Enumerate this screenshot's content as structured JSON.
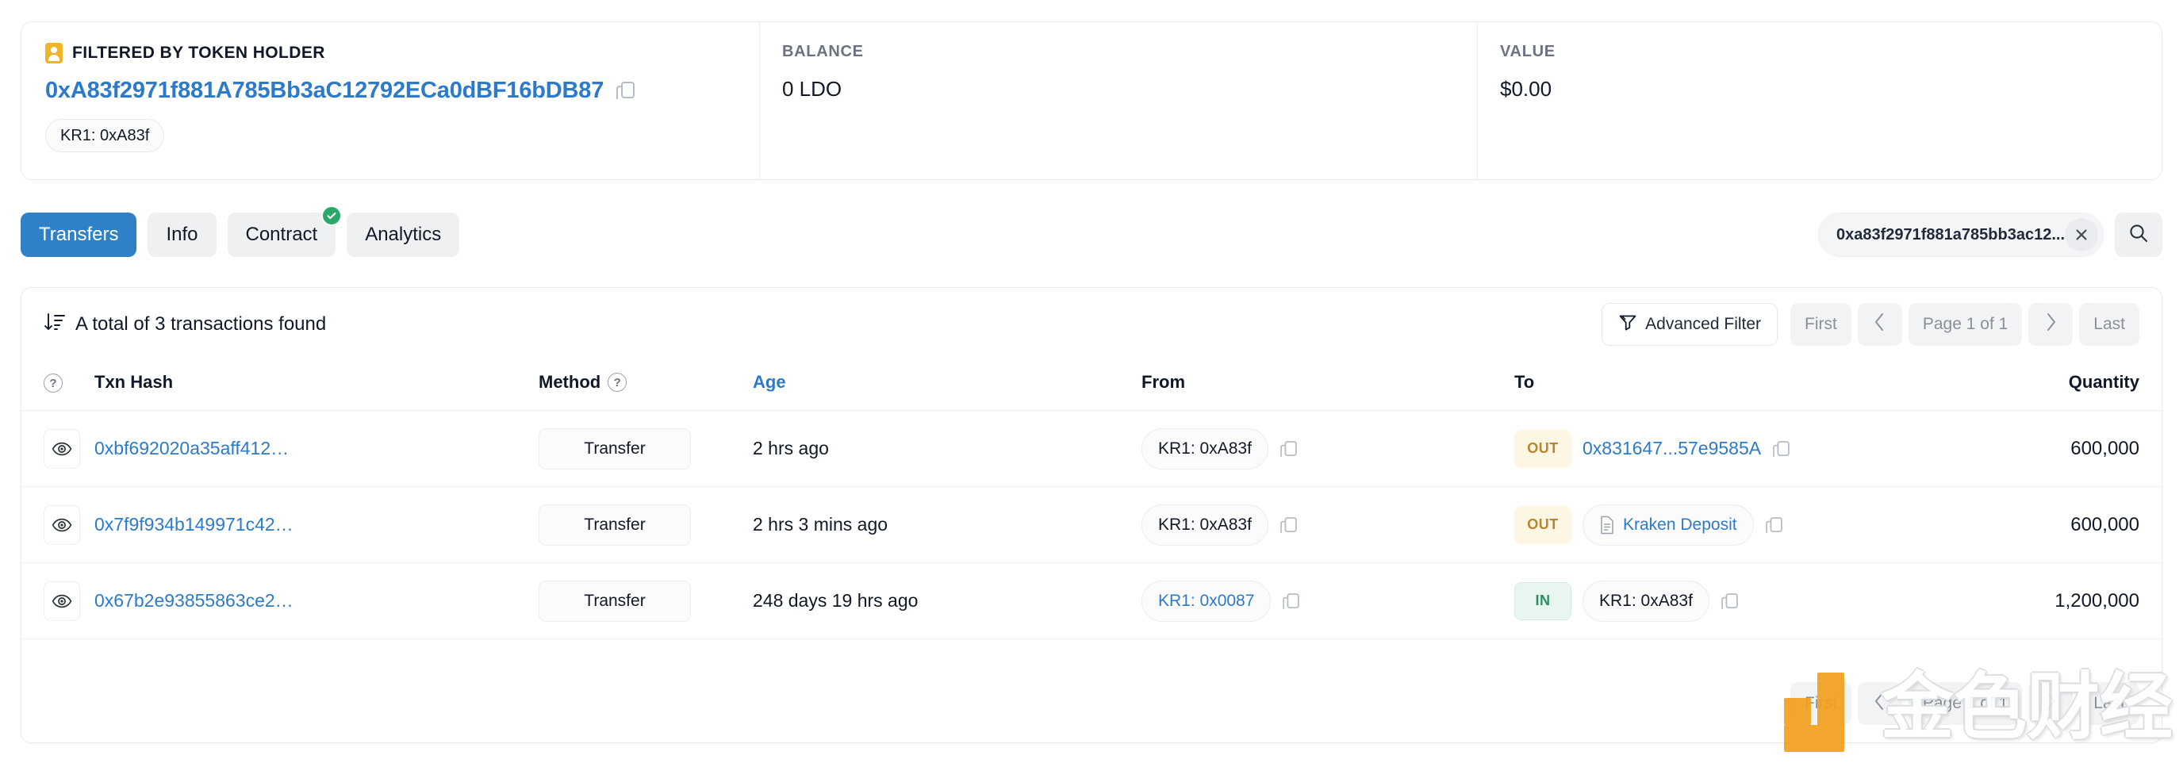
{
  "holder_card": {
    "filtered_label": "FILTERED BY TOKEN HOLDER",
    "holder_icon": "address-book-icon",
    "address": "0xA83f2971f881A785Bb3aC12792ECa0dBF16bDB87",
    "copy_icon": "copy-icon",
    "tag": "KR1: 0xA83f",
    "balance_label": "BALANCE",
    "balance_value": "0 LDO",
    "value_label": "VALUE",
    "value_value": "$0.00"
  },
  "tabs": [
    {
      "label": "Transfers",
      "active": true,
      "badge": false
    },
    {
      "label": "Info",
      "active": false,
      "badge": false
    },
    {
      "label": "Contract",
      "active": false,
      "badge": true
    },
    {
      "label": "Analytics",
      "active": false,
      "badge": false
    }
  ],
  "search": {
    "value": "0xa83f2971f881a785bb3ac12...",
    "clear_icon": "close-icon",
    "search_icon": "search-icon"
  },
  "toolbar": {
    "sort_icon": "sort-descending-icon",
    "total_text": "A total of 3 transactions found",
    "advanced_filter": "Advanced Filter",
    "filter_icon": "funnel-icon",
    "first": "First",
    "prev_icon": "chevron-left-icon",
    "page_label": "Page 1 of 1",
    "next_icon": "chevron-right-icon",
    "last": "Last"
  },
  "table": {
    "columns": {
      "help": "?",
      "txn_hash": "Txn Hash",
      "method": "Method",
      "method_help": "?",
      "age": "Age",
      "from": "From",
      "to": "To",
      "quantity": "Quantity"
    },
    "rows": [
      {
        "eye_icon": "eye-icon",
        "hash": "0xbf692020a35aff412…",
        "method": "Transfer",
        "age": "2 hrs ago",
        "from": {
          "label": "KR1: 0xA83f",
          "link": false,
          "named": false
        },
        "from_copy_icon": "copy-icon",
        "direction": "OUT",
        "to": {
          "label": "0x831647...57e9585A",
          "link": true,
          "named": false,
          "plain_link": true
        },
        "to_copy_icon": "copy-icon",
        "quantity": "600,000"
      },
      {
        "eye_icon": "eye-icon",
        "hash": "0x7f9f934b149971c42…",
        "method": "Transfer",
        "age": "2 hrs 3 mins ago",
        "from": {
          "label": "KR1: 0xA83f",
          "link": false,
          "named": false
        },
        "from_copy_icon": "copy-icon",
        "direction": "OUT",
        "to": {
          "label": "Kraken Deposit",
          "link": true,
          "named": true,
          "plain_link": false
        },
        "to_copy_icon": "copy-icon",
        "quantity": "600,000"
      },
      {
        "eye_icon": "eye-icon",
        "hash": "0x67b2e93855863ce2…",
        "method": "Transfer",
        "age": "248 days 19 hrs ago",
        "from": {
          "label": "KR1: 0x0087",
          "link": true,
          "named": false
        },
        "from_copy_icon": "copy-icon",
        "direction": "IN",
        "to": {
          "label": "KR1: 0xA83f",
          "link": false,
          "named": false,
          "plain_link": false
        },
        "to_copy_icon": "copy-icon",
        "quantity": "1,200,000"
      }
    ]
  },
  "bottom_pager": {
    "first": "First",
    "prev_icon": "chevron-left-icon",
    "page_label": "Page 1 of 1",
    "next_icon": "chevron-right-icon",
    "last": "Last"
  },
  "watermark": {
    "text": "金色财经",
    "logo_color": "#F2A01E"
  },
  "colors": {
    "accent_blue": "#2c7ac9",
    "tab_active": "#2f80c6",
    "out_badge_bg": "#fdf6e3",
    "out_badge_text": "#b7852a",
    "in_badge_bg": "#e9f6ef",
    "in_badge_text": "#2e8c63",
    "holder_icon": "#f0b429"
  }
}
